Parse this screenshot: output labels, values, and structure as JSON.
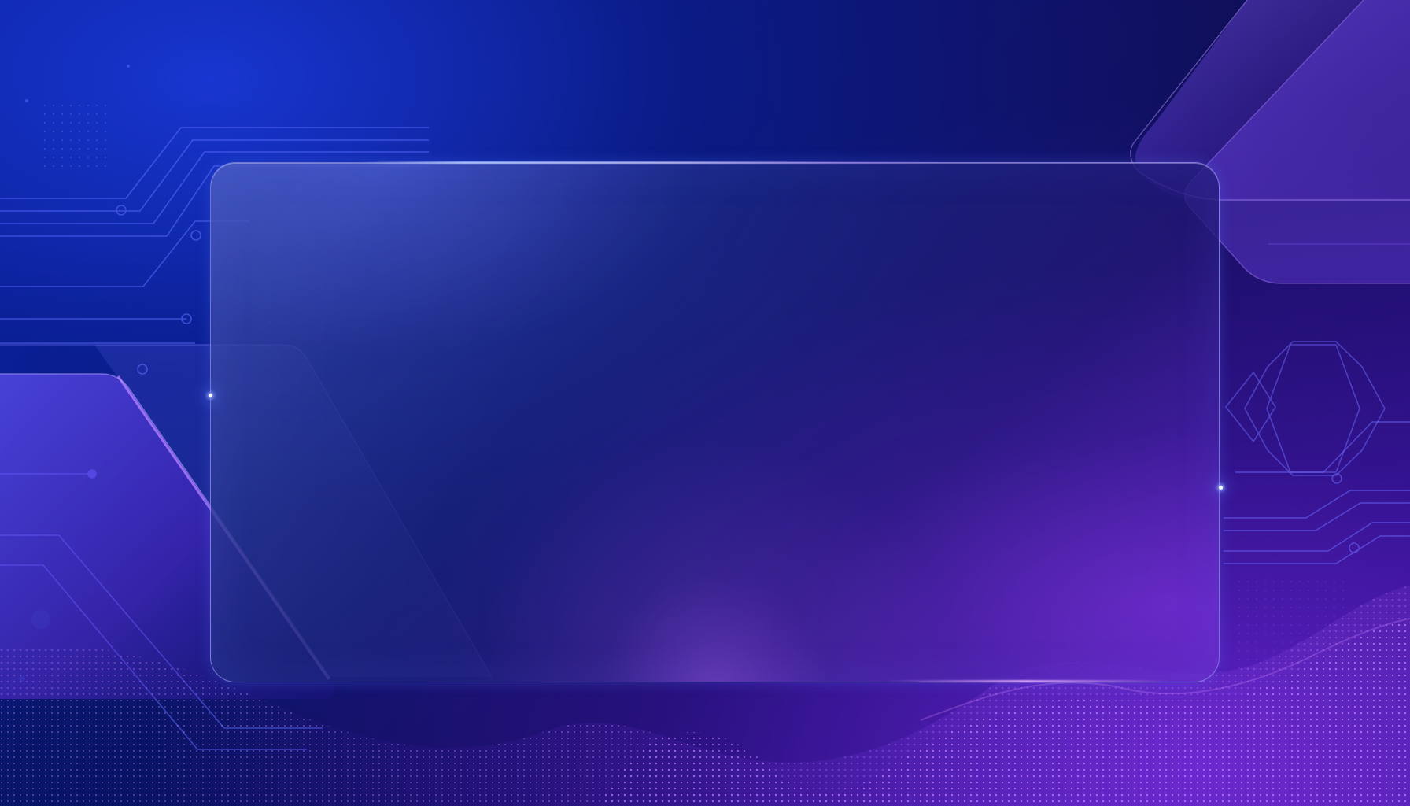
{
  "scene": {
    "colors": {
      "deep_navy": "#050a3a",
      "royal_blue": "#1533d3",
      "indigo": "#2c2a9d",
      "violet": "#7c34e8",
      "glass_border": "#ada6ff"
    },
    "elements": {
      "background": "abstract-tech-background",
      "panel": "empty-glass-panel",
      "left_shards": "translucent-angled-shards",
      "right_shards": "translucent-angled-shards",
      "circuits": "circuit-line-decorations",
      "hexagons": "hexagon-outline-decorations",
      "wave": "dotted-particle-wave"
    }
  }
}
